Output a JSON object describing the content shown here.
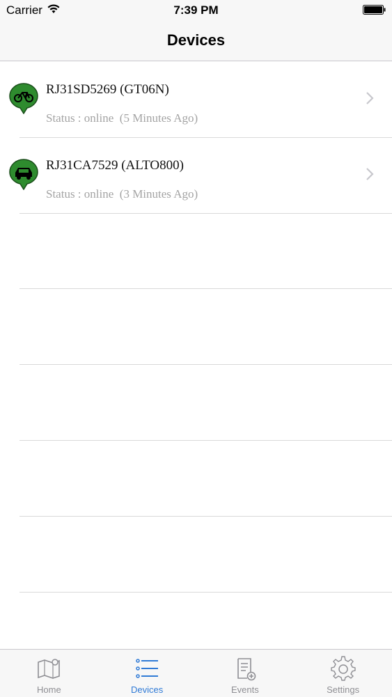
{
  "status_bar": {
    "carrier": "Carrier",
    "time": "7:39 PM"
  },
  "nav": {
    "title": "Devices"
  },
  "devices": [
    {
      "name": "RJ31SD5269 (GT06N)",
      "status": "Status : online  (5 Minutes Ago)",
      "icon": "motorcycle-pin-icon"
    },
    {
      "name": "RJ31CA7529 (ALTO800)",
      "status": "Status : online  (3 Minutes Ago)",
      "icon": "car-pin-icon"
    }
  ],
  "tabs": [
    {
      "label": "Home",
      "icon": "map-icon",
      "active": false
    },
    {
      "label": "Devices",
      "icon": "list-icon",
      "active": true
    },
    {
      "label": "Events",
      "icon": "document-add-icon",
      "active": false
    },
    {
      "label": "Settings",
      "icon": "gear-icon",
      "active": false
    }
  ],
  "colors": {
    "accent": "#2f7ad6",
    "pin_green": "#2e8b2e",
    "inactive_tab": "#8e8e93",
    "status_text": "#a3a3a3"
  }
}
